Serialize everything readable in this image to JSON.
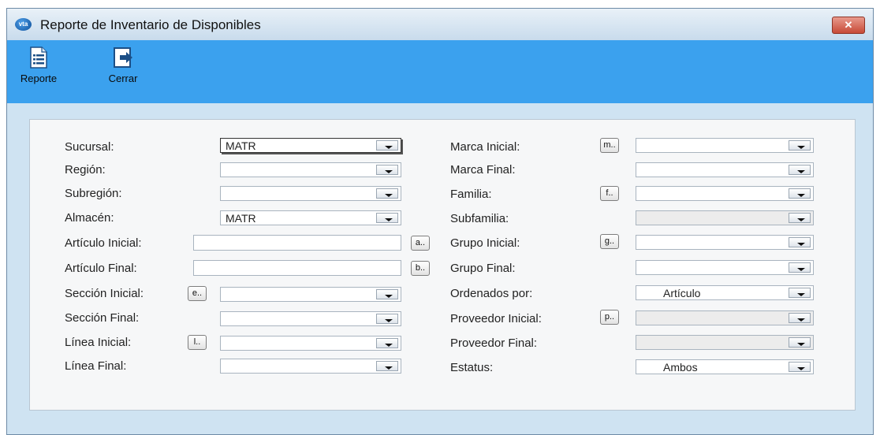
{
  "window": {
    "title": "Reporte de Inventario de Disponibles",
    "app_icon_text": "vta",
    "close_symbol": "✕"
  },
  "toolbar": {
    "reporte_label": "Reporte",
    "cerrar_label": "Cerrar"
  },
  "left": {
    "sucursal": {
      "label": "Sucursal:",
      "value": "MATR"
    },
    "region": {
      "label": "Región:",
      "value": ""
    },
    "subregion": {
      "label": "Subregión:",
      "value": ""
    },
    "almacen": {
      "label": "Almacén:",
      "value": "MATR"
    },
    "articulo_inicial": {
      "label": "Artículo Inicial:",
      "value": "",
      "button": "a.."
    },
    "articulo_final": {
      "label": "Artículo Final:",
      "value": "",
      "button": "b.."
    },
    "seccion_inicial": {
      "label": "Sección Inicial:",
      "value": "",
      "button": "e.."
    },
    "seccion_final": {
      "label": "Sección Final:",
      "value": ""
    },
    "linea_inicial": {
      "label": "Línea Inicial:",
      "value": "",
      "button": "l.."
    },
    "linea_final": {
      "label": "Línea Final:",
      "value": ""
    }
  },
  "right": {
    "marca_inicial": {
      "label": "Marca Inicial:",
      "value": "",
      "button": "m.."
    },
    "marca_final": {
      "label": "Marca Final:",
      "value": ""
    },
    "familia": {
      "label": "Familia:",
      "value": "",
      "button": "f.."
    },
    "subfamilia": {
      "label": "Subfamilia:",
      "value": ""
    },
    "grupo_inicial": {
      "label": "Grupo Inicial:",
      "value": "",
      "button": "g.."
    },
    "grupo_final": {
      "label": "Grupo Final:",
      "value": ""
    },
    "ordenados_por": {
      "label": "Ordenados por:",
      "value": "Artículo"
    },
    "proveedor_inicial": {
      "label": "Proveedor Inicial:",
      "value": "",
      "button": "p.."
    },
    "proveedor_final": {
      "label": "Proveedor Final:",
      "value": ""
    },
    "estatus": {
      "label": "Estatus:",
      "value": "Ambos"
    }
  },
  "colors": {
    "toolbar_bg": "#3ba1ee",
    "window_bg": "#cfe3f2",
    "panel_bg": "#f6f7f8"
  }
}
